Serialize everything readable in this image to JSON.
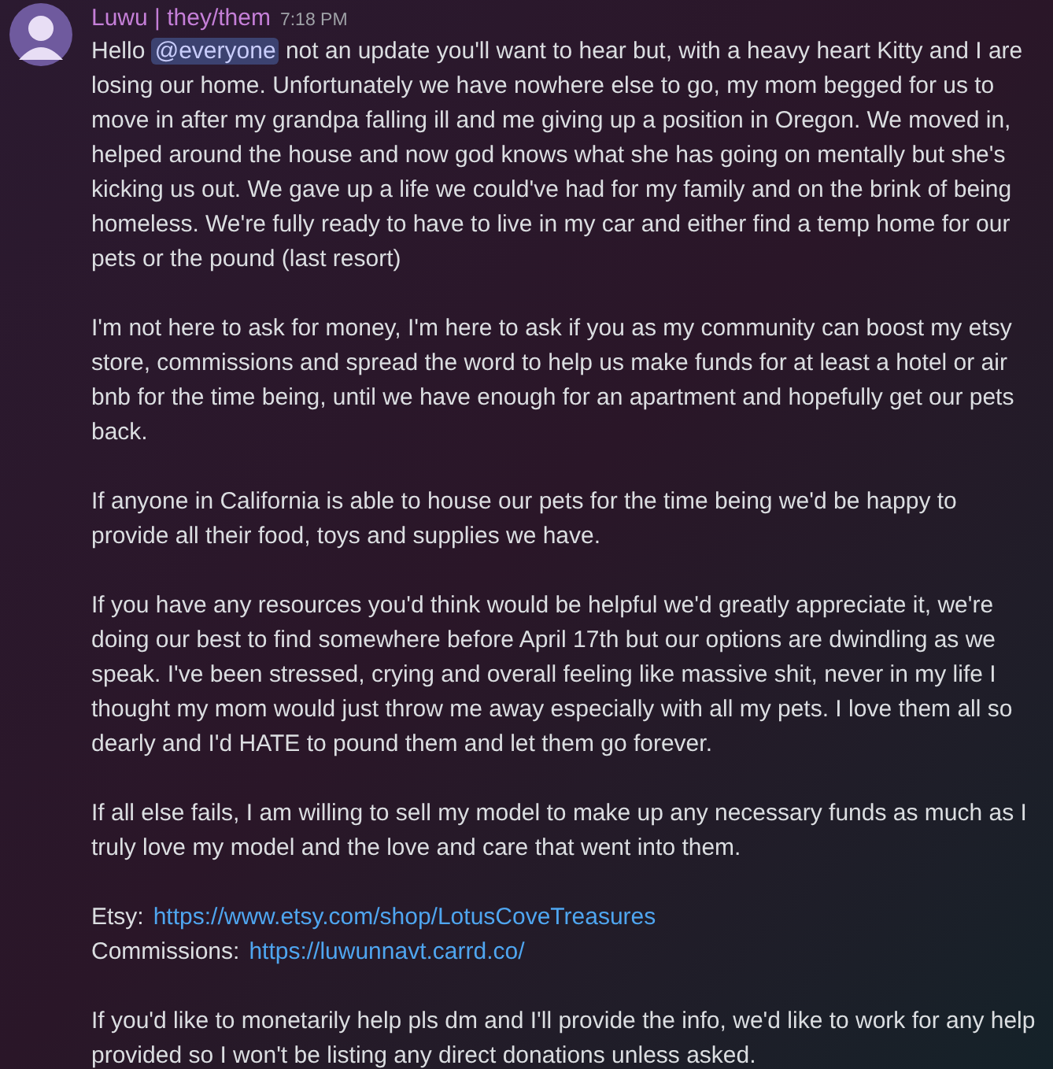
{
  "message": {
    "author": "Luwu | they/them",
    "timestamp": "7:18 PM",
    "intro": {
      "before": "Hello",
      "mention": "@everyone",
      "after": "not an update you'll want to hear but, with a heavy heart Kitty and I are losing our home. Unfortunately we have nowhere else to go, my mom begged for us to move in after my grandpa falling ill and me giving up a position in Oregon. We moved in, helped around the house and now god knows what she has going on mentally but she's kicking us out. We gave up a life we could've had for my family and on the brink of being homeless. We're fully ready to have to live in my car and either find a temp home for our pets or the pound (last resort)"
    },
    "paragraphs": [
      "I'm not here to ask for money, I'm here to ask if you as my community can boost my etsy store, commissions and spread the word to help us make funds for at least a hotel or air bnb for the time being, until we have enough for an apartment and hopefully get our pets back.",
      "If anyone in California is able to house our pets for the time being we'd be happy to provide all their food, toys and supplies we have.",
      "If you have any resources you'd think would be helpful we'd greatly appreciate it, we're doing our best to find somewhere before April 17th but our options are dwindling as we speak. I've been stressed, crying and overall feeling like massive shit, never in my life I thought my mom would just throw me away especially with all my pets. I love them all so dearly and I'd HATE to pound them and let them go forever.",
      "If all else fails, I am willing to sell my model to make up any necessary funds as much as I truly love my model and the love and care that went into them."
    ],
    "links": [
      {
        "label": "Etsy:",
        "url": "https://www.etsy.com/shop/LotusCoveTreasures"
      },
      {
        "label": "Commissions:",
        "url": "https://luwunnavt.carrd.co/"
      }
    ],
    "closing": "If you'd like to monetarily help pls dm and I'll provide the info, we'd like to work for any help provided so I won't be listing any direct donations unless asked."
  }
}
